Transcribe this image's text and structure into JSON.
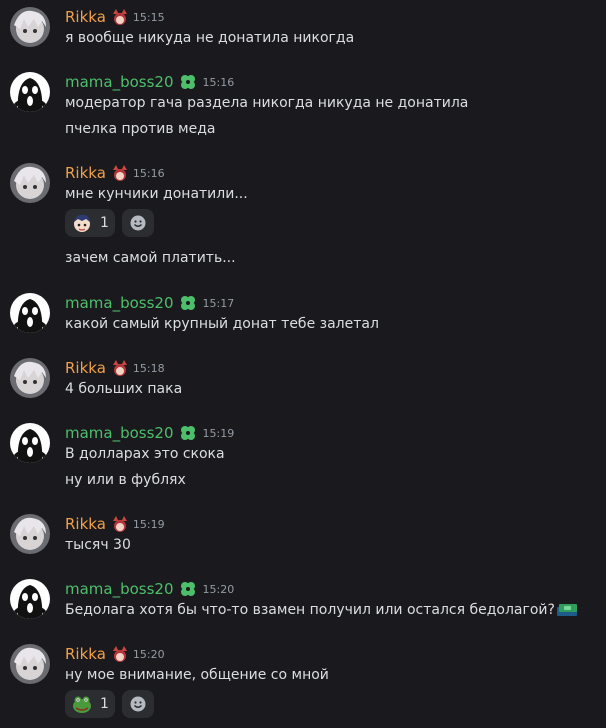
{
  "users": {
    "rikka": {
      "name": "Rikka",
      "color": "#f0a04b"
    },
    "mama": {
      "name": "mama_boss20",
      "color": "#4dbf6b"
    }
  },
  "messages": [
    {
      "time": "15:15",
      "lines": [
        "я вообще никуда не донатила никогда"
      ]
    },
    {
      "time": "15:16",
      "lines": [
        "модератор гача раздела никогда никуда не донатила",
        "пчелка против меда"
      ]
    },
    {
      "time": "15:16",
      "lines": [
        "мне кунчики донатили...",
        "зачем самой платить..."
      ],
      "reaction": {
        "emoji": "anime-boy-emoji",
        "count": "1"
      }
    },
    {
      "time": "15:17",
      "lines": [
        "какой самый крупный донат тебе залетал"
      ]
    },
    {
      "time": "15:18",
      "lines": [
        "4 больших пака"
      ]
    },
    {
      "time": "15:19",
      "lines": [
        "В долларах это скока",
        "ну или в фублях"
      ]
    },
    {
      "time": "15:19",
      "lines": [
        "тысяч 30"
      ]
    },
    {
      "time": "15:20",
      "lines": [
        "Бедолага хотя бы что-то взамен получил или остался бедолагой?"
      ],
      "inline_emoji": "cash-stack-emoji"
    },
    {
      "time": "15:20",
      "lines": [
        "ну мое внимание, общение со мной"
      ],
      "reaction": {
        "emoji": "frog-emoji",
        "count": "1"
      }
    }
  ]
}
